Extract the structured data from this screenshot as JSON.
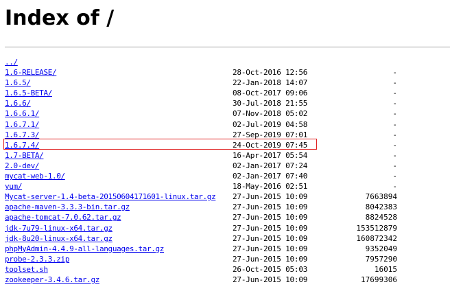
{
  "page": {
    "title": "Index of /"
  },
  "entries": [
    {
      "name": "../",
      "date": "",
      "size": ""
    },
    {
      "name": "1.6-RELEASE/",
      "date": "28-Oct-2016 12:56",
      "size": "-"
    },
    {
      "name": "1.6.5/",
      "date": "22-Jan-2018 14:07",
      "size": "-"
    },
    {
      "name": "1.6.5-BETA/",
      "date": "08-Oct-2017 09:06",
      "size": "-"
    },
    {
      "name": "1.6.6/",
      "date": "30-Jul-2018 21:55",
      "size": "-"
    },
    {
      "name": "1.6.6.1/",
      "date": "07-Nov-2018 05:02",
      "size": "-"
    },
    {
      "name": "1.6.7.1/",
      "date": "02-Jul-2019 04:58",
      "size": "-"
    },
    {
      "name": "1.6.7.3/",
      "date": "27-Sep-2019 07:01",
      "size": "-"
    },
    {
      "name": "1.6.7.4/",
      "date": "24-Oct-2019 07:45",
      "size": "-"
    },
    {
      "name": "1.7-BETA/",
      "date": "16-Apr-2017 05:54",
      "size": "-"
    },
    {
      "name": "2.0-dev/",
      "date": "02-Jan-2017 07:24",
      "size": "-"
    },
    {
      "name": "mycat-web-1.0/",
      "date": "02-Jan-2017 07:40",
      "size": "-"
    },
    {
      "name": "yum/",
      "date": "18-May-2016 02:51",
      "size": "-"
    },
    {
      "name": "Mycat-server-1.4-beta-20150604171601-linux.tar.gz",
      "date": "27-Jun-2015 10:09",
      "size": "7663894"
    },
    {
      "name": "apache-maven-3.3.3-bin.tar.gz",
      "date": "27-Jun-2015 10:09",
      "size": "8042383"
    },
    {
      "name": "apache-tomcat-7.0.62.tar.gz",
      "date": "27-Jun-2015 10:09",
      "size": "8824528"
    },
    {
      "name": "jdk-7u79-linux-x64.tar.gz",
      "date": "27-Jun-2015 10:09",
      "size": "153512879"
    },
    {
      "name": "jdk-8u20-linux-x64.tar.gz",
      "date": "27-Jun-2015 10:09",
      "size": "160872342"
    },
    {
      "name": "phpMyAdmin-4.4.9-all-languages.tar.gz",
      "date": "27-Jun-2015 10:09",
      "size": "9352049"
    },
    {
      "name": "probe-2.3.3.zip",
      "date": "27-Jun-2015 10:09",
      "size": "7957290"
    },
    {
      "name": "toolset.sh",
      "date": "26-Oct-2015 05:03",
      "size": "16015"
    },
    {
      "name": "zookeeper-3.4.6.tar.gz",
      "date": "27-Jun-2015 10:09",
      "size": "17699306"
    }
  ],
  "colors": {
    "link": "#0000ee",
    "highlight_box": "#e02020",
    "divider": "#a0a0a0"
  }
}
